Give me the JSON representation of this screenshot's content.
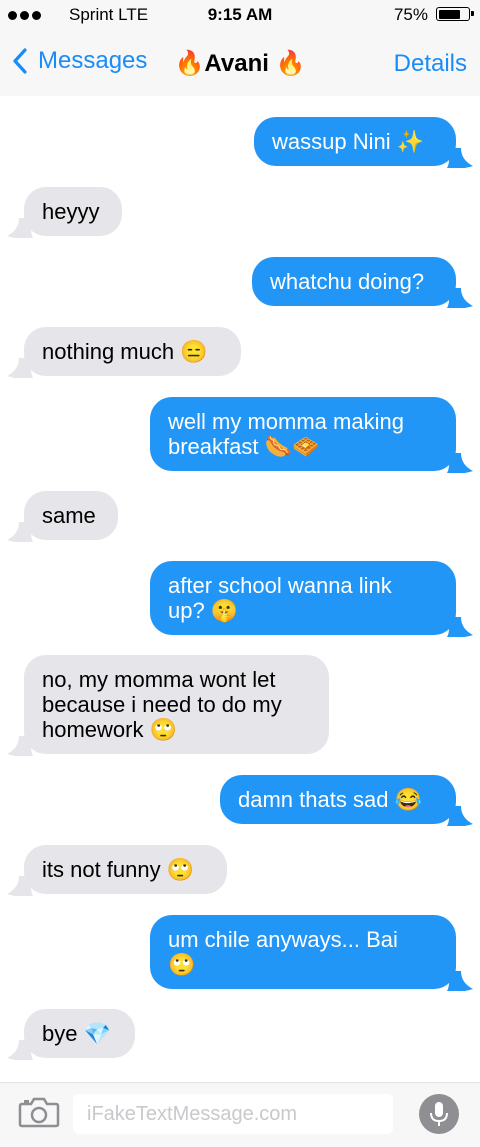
{
  "status_bar": {
    "carrier": "Sprint  LTE",
    "time": "9:15 AM",
    "battery_percent": "75%",
    "battery_level": 0.75
  },
  "nav": {
    "back_label": "Messages",
    "title": "🔥Avani 🔥",
    "details_label": "Details"
  },
  "messages": [
    {
      "from": "me",
      "text": "wassup Nini ✨"
    },
    {
      "from": "them",
      "text": "heyyy"
    },
    {
      "from": "me",
      "text": "whatchu doing?"
    },
    {
      "from": "them",
      "text": "nothing much 😑"
    },
    {
      "from": "me",
      "text": "well my momma making\nbreakfast 🌭🧇"
    },
    {
      "from": "them",
      "text": "same"
    },
    {
      "from": "me",
      "text": "after school wanna link\nup? 🤫"
    },
    {
      "from": "them",
      "text": "no, my momma wont let\nbecause i need to do my\nhomework 🙄"
    },
    {
      "from": "me",
      "text": "damn thats sad 😂"
    },
    {
      "from": "them",
      "text": "its not funny 🙄"
    },
    {
      "from": "me",
      "text": "um chile anyways... Bai\n🙄"
    },
    {
      "from": "them",
      "text": "bye 💎"
    }
  ],
  "input": {
    "placeholder": "iFakeTextMessage.com"
  },
  "colors": {
    "accent": "#1a8cf7",
    "outgoing_bubble": "#2196f7",
    "incoming_bubble": "#e5e5ea"
  }
}
